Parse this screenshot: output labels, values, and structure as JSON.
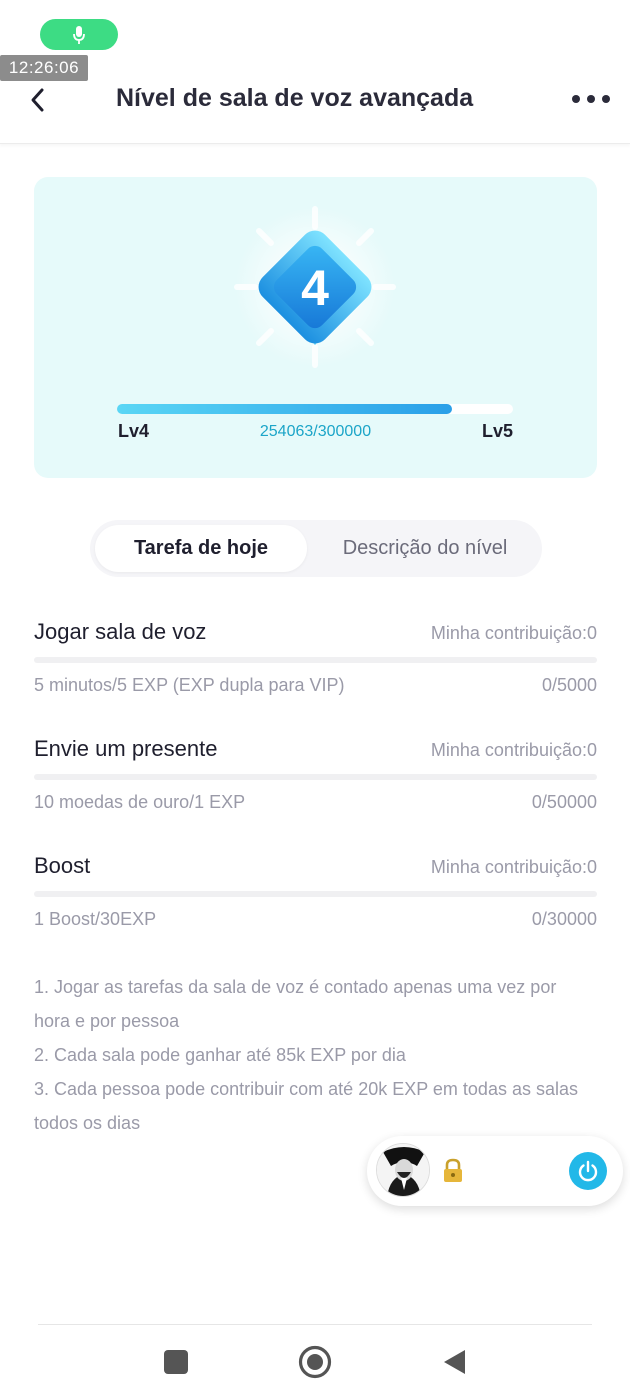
{
  "status": {
    "time": "12:26:06"
  },
  "header": {
    "title": "Nível de sala de voz avançada"
  },
  "level_card": {
    "current_level_number": "4",
    "current_level_label": "Lv4",
    "next_level_label": "Lv5",
    "exp_text": "254063/300000",
    "progress_fraction": 0.8469
  },
  "tabs": [
    {
      "label": "Tarefa de hoje",
      "active": true
    },
    {
      "label": "Descrição do nível",
      "active": false
    }
  ],
  "tasks": [
    {
      "title": "Jogar sala de voz",
      "contribution": "Minha contribuição:0",
      "description": "5 minutos/5 EXP (EXP dupla para VIP)",
      "progress": "0/5000"
    },
    {
      "title": "Envie um presente",
      "contribution": "Minha contribuição:0",
      "description": "10 moedas de ouro/1 EXP",
      "progress": "0/50000"
    },
    {
      "title": "Boost",
      "contribution": "Minha contribuição:0",
      "description": "1 Boost/30EXP",
      "progress": "0/30000"
    }
  ],
  "notes": [
    "1. Jogar as tarefas da sala de voz é contado apenas uma vez por hora e por pessoa",
    "2. Cada sala pode ganhar até 85k EXP por dia",
    "3. Cada pessoa pode contribuir com até 20k EXP em todas as salas todos os dias"
  ],
  "colors": {
    "accent": "#22b8e8",
    "card_bg": "#e6fafa",
    "mic_green": "#3ddc84",
    "muted_text": "#9a9aa8"
  },
  "icons": {
    "back": "chevron-left-icon",
    "more": "more-dots-icon",
    "mic": "microphone-icon",
    "badge": "level-badge-icon",
    "lock": "lock-icon",
    "power": "power-icon",
    "nav_recent": "square-icon",
    "nav_home": "circle-icon",
    "nav_back": "triangle-back-icon"
  }
}
